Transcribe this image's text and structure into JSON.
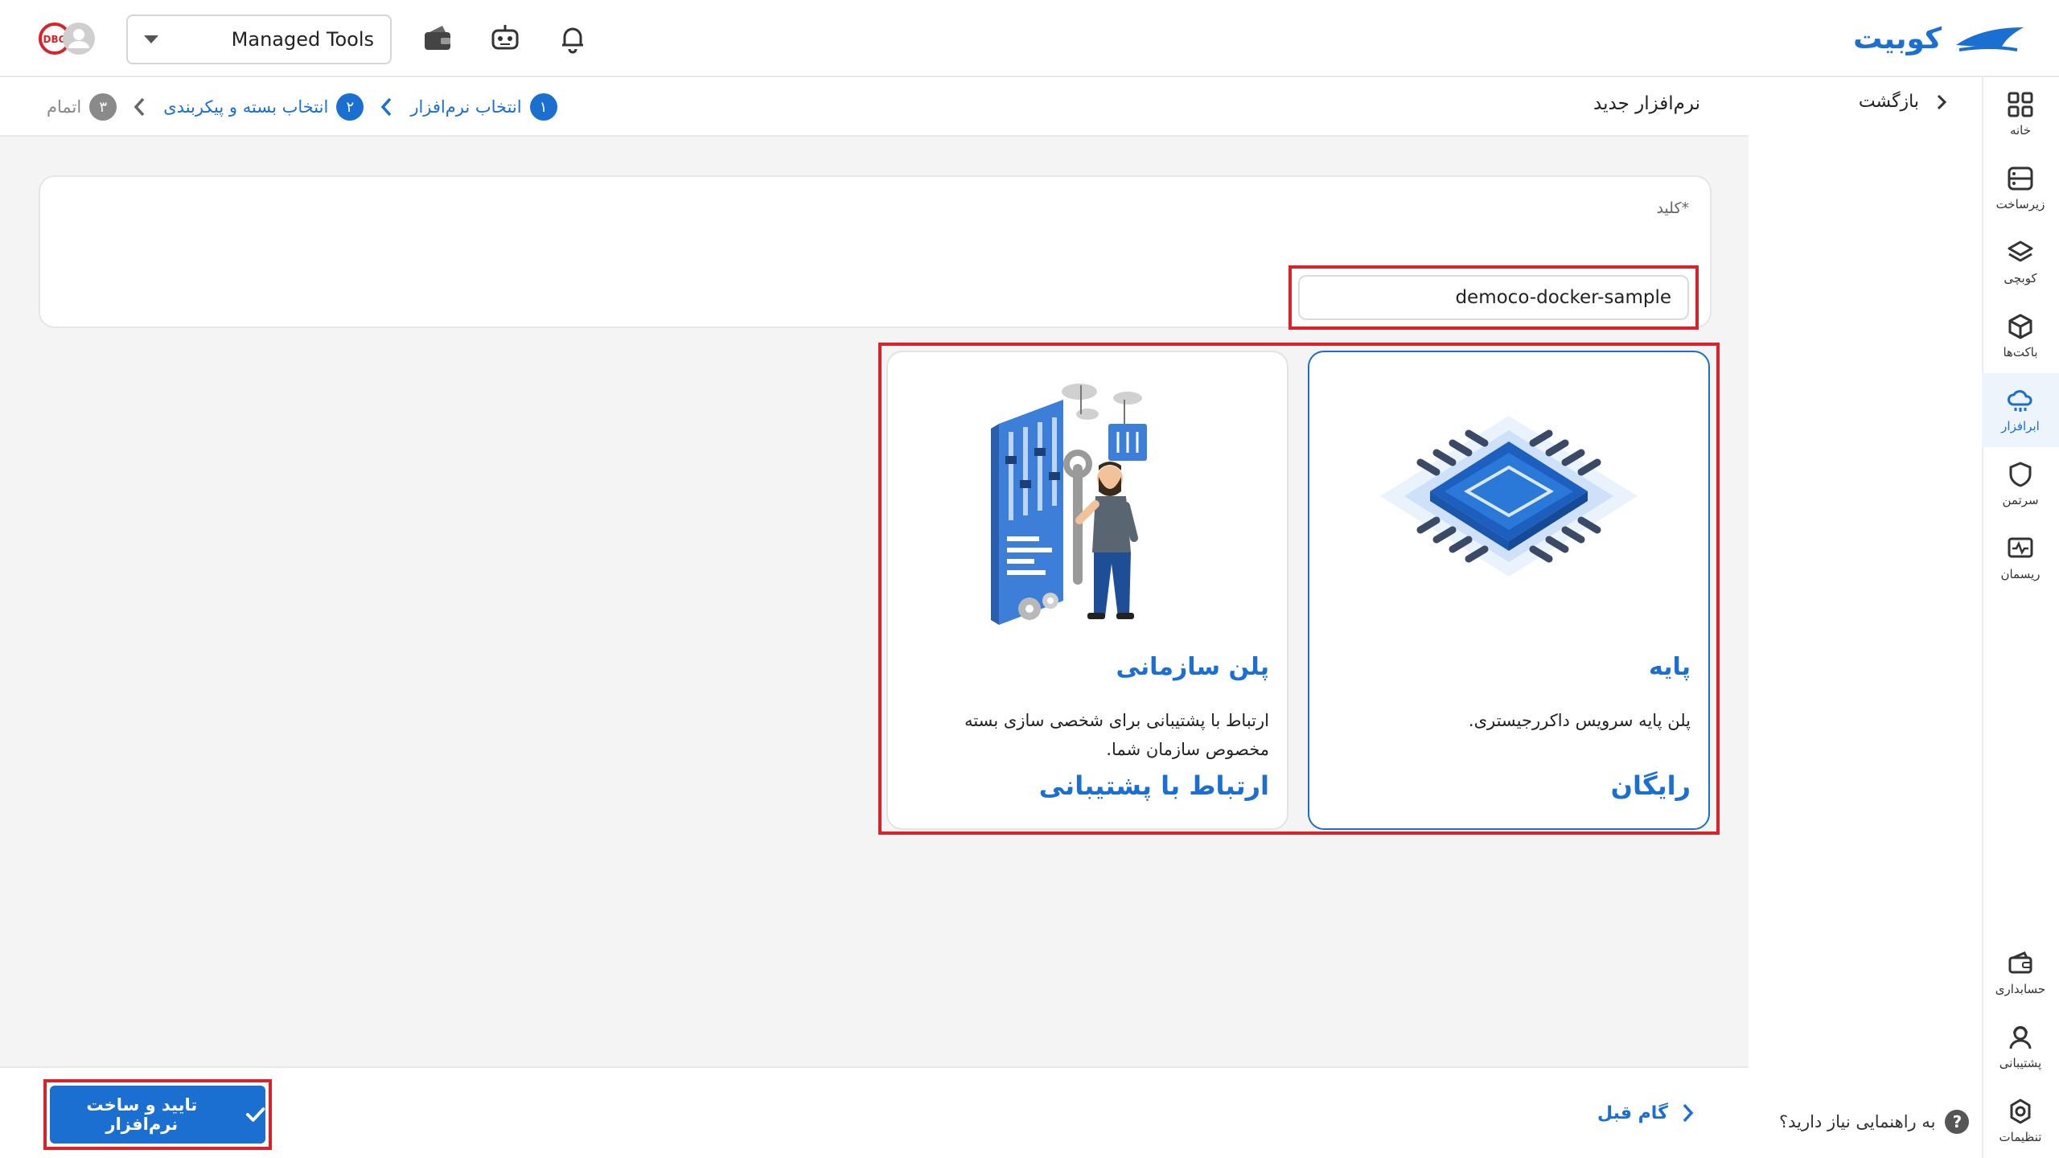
{
  "topbar": {
    "logo_text": "کوبیت",
    "workspace_value": "Managed Tools",
    "icons": [
      "bell-icon",
      "robot-icon",
      "wallet-icon",
      "avatar-icon",
      "debug-badge-icon"
    ]
  },
  "rail": {
    "items": [
      {
        "label": "خانه",
        "icon": "grid-icon"
      },
      {
        "label": "زیرساخت",
        "icon": "server-icon"
      },
      {
        "label": "کوبچی",
        "icon": "layers-icon"
      },
      {
        "label": "باکت‌ها",
        "icon": "box-icon"
      },
      {
        "label": "ابرافزار",
        "icon": "cloud-app-icon"
      },
      {
        "label": "سرتمن",
        "icon": "shield-icon"
      },
      {
        "label": "ریسمان",
        "icon": "monitor-icon"
      },
      {
        "label": "حسابداری",
        "icon": "wallet-icon"
      },
      {
        "label": "پشتیبانی",
        "icon": "support-icon"
      },
      {
        "label": "تنظیمات",
        "icon": "gear-icon"
      }
    ],
    "active_index": 4
  },
  "subside": {
    "back_label": "بازگشت",
    "help_text": "به راهنمایی نیاز دارید؟",
    "help_mark": "?"
  },
  "header": {
    "page_title": "نرم‌افزار جدید",
    "steps": [
      {
        "num": "۱",
        "label": "انتخاب نرم‌افزار"
      },
      {
        "num": "۲",
        "label": "انتخاب بسته و پیکربندی"
      },
      {
        "num": "۳",
        "label": "اتمام"
      }
    ]
  },
  "form": {
    "key_label": "کلید*",
    "key_value": "democo-docker-sample"
  },
  "plans": [
    {
      "title": "پایه",
      "description": "پلن پایه سرویس داکررجیستری.",
      "price": "رایگان",
      "selected": true,
      "art": "chip-illustration"
    },
    {
      "title": "پلن سازمانی",
      "description": "ارتباط با پشتیبانی برای شخصی سازی بسته مخصوص سازمان شما.",
      "price": "ارتباط با پشتیبانی",
      "selected": false,
      "art": "engineer-illustration"
    }
  ],
  "footer": {
    "confirm_label": "تایید و ساخت نرم‌افزار",
    "prev_label": "گام قبل"
  },
  "colors": {
    "accent": "#1a6fd0",
    "highlight": "#d8232a",
    "background": "#f4f4f4"
  }
}
